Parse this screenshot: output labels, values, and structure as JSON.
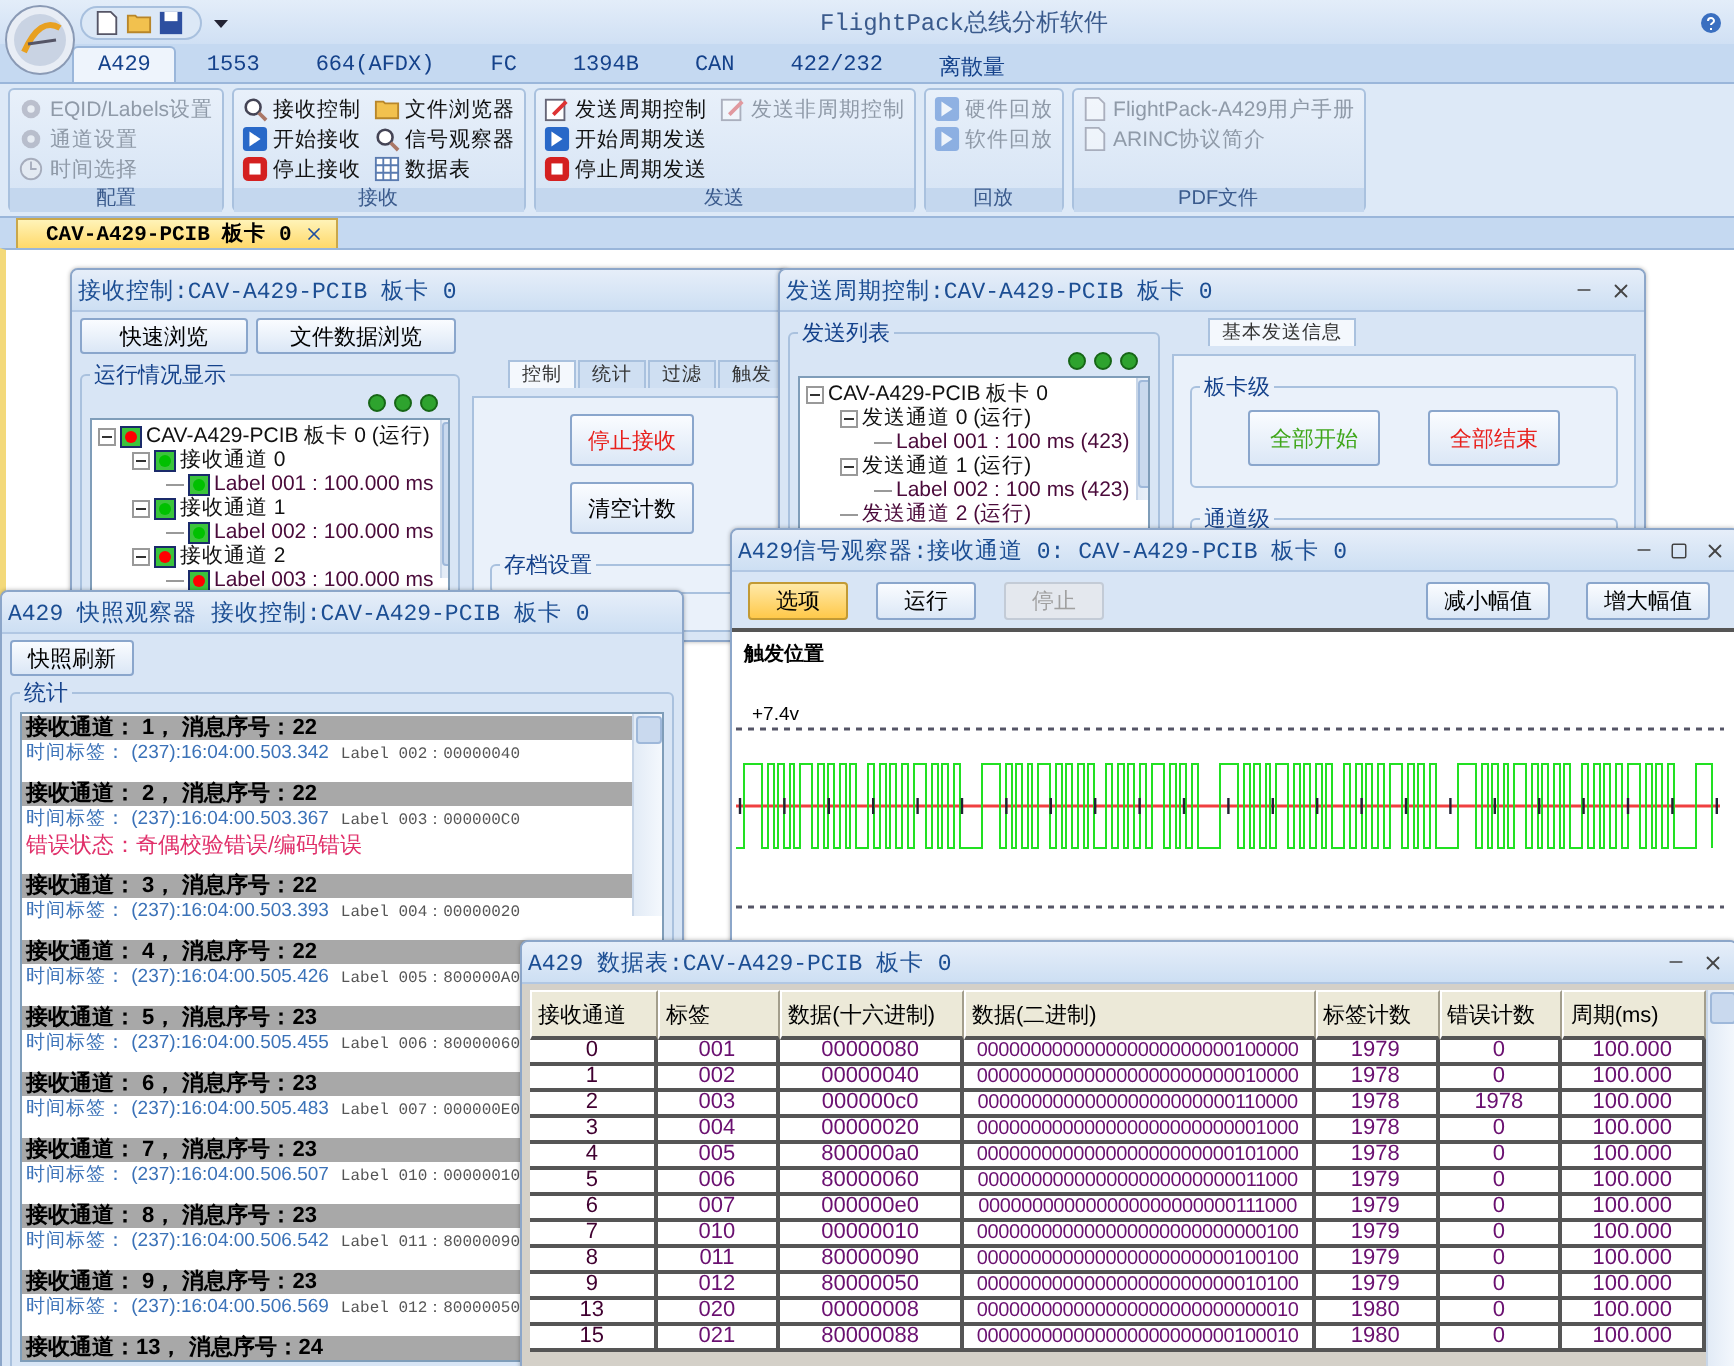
{
  "app": {
    "title": "FlightPack总线分析软件"
  },
  "tabs": [
    {
      "label": "A429",
      "selected": true
    },
    {
      "label": "1553",
      "selected": false
    },
    {
      "label": "664(AFDX)",
      "selected": false
    },
    {
      "label": "FC",
      "selected": false
    },
    {
      "label": "1394B",
      "selected": false
    },
    {
      "label": "CAN",
      "selected": false
    },
    {
      "label": "422/232",
      "selected": false
    },
    {
      "label": "离散量",
      "selected": false
    }
  ],
  "ribbon": {
    "groups": [
      {
        "title": "配置",
        "items": [
          {
            "label": "EQID/Labels设置",
            "disabled": true
          },
          {
            "label": "通道设置",
            "disabled": true
          },
          {
            "label": "时间选择",
            "disabled": true
          }
        ]
      },
      {
        "title": "接收",
        "items": [
          {
            "label": "接收控制",
            "disabled": false
          },
          {
            "label": "开始接收",
            "disabled": false
          },
          {
            "label": "停止接收",
            "disabled": false
          },
          {
            "label": "文件浏览器",
            "disabled": false
          },
          {
            "label": "信号观察器",
            "disabled": false
          },
          {
            "label": "数据表",
            "disabled": false
          }
        ]
      },
      {
        "title": "发送",
        "items": [
          {
            "label": "发送周期控制",
            "disabled": false
          },
          {
            "label": "开始周期发送",
            "disabled": false
          },
          {
            "label": "停止周期发送",
            "disabled": false
          },
          {
            "label": "发送非周期控制",
            "disabled": true
          }
        ]
      },
      {
        "title": "回放",
        "items": [
          {
            "label": "硬件回放",
            "disabled": true
          },
          {
            "label": "软件回放",
            "disabled": true
          }
        ]
      },
      {
        "title": "PDF文件",
        "items": [
          {
            "label": "FlightPack-A429用户手册",
            "disabled": true
          },
          {
            "label": "ARINC协议简介",
            "disabled": true
          }
        ]
      }
    ]
  },
  "document_tab": {
    "label": "CAV-A429-PCIB 板卡 0"
  },
  "receive_window": {
    "title": "接收控制:CAV-A429-PCIB 板卡 0",
    "buttons": [
      "快速浏览",
      "文件数据浏览"
    ],
    "status_group": {
      "title": "运行情况显示",
      "tree": [
        {
          "label": "CAV-A429-PCIB 板卡 0 (运行)",
          "color": "#ff0000",
          "children": [
            {
              "label": "接收通道 0",
              "color": "#00c000",
              "children": [
                {
                  "label": "Label 001 : 100.000 ms",
                  "color": "#00c000"
                }
              ]
            },
            {
              "label": "接收通道 1",
              "color": "#00c000",
              "children": [
                {
                  "label": "Label 002 : 100.000 ms",
                  "color": "#00c000"
                }
              ]
            },
            {
              "label": "接收通道 2",
              "color": "#ff0000",
              "children": [
                {
                  "label": "Label 003 : 100.000 ms",
                  "color": "#ff0000"
                }
              ]
            }
          ]
        }
      ]
    },
    "tabs": [
      {
        "label": "控制",
        "selected": true
      },
      {
        "label": "统计",
        "selected": false
      },
      {
        "label": "过滤",
        "selected": false
      },
      {
        "label": "触发",
        "selected": false
      }
    ],
    "actions": [
      {
        "label": "停止接收",
        "kind": "danger"
      },
      {
        "label": "清空计数",
        "kind": "normal"
      }
    ],
    "archive_group": {
      "title": "存档设置"
    }
  },
  "send_window": {
    "title": "发送周期控制:CAV-A429-PCIB 板卡 0",
    "list_group": {
      "title": "发送列表",
      "tree": [
        {
          "label": "CAV-A429-PCIB 板卡 0",
          "children": [
            {
              "label": "发送通道 0 (运行)",
              "children": [
                {
                  "label": "Label 001 : 100 ms (423)"
                }
              ]
            },
            {
              "label": "发送通道 1 (运行)",
              "children": [
                {
                  "label": "Label 002 : 100 ms (423)"
                }
              ]
            },
            {
              "label": "发送通道 2 (运行)"
            }
          ]
        }
      ]
    },
    "tabs": [
      {
        "label": "基本发送信息",
        "selected": true
      }
    ],
    "board_group": {
      "title": "板卡级",
      "buttons": [
        {
          "label": "全部开始",
          "kind": "start"
        },
        {
          "label": "全部结束",
          "kind": "danger"
        }
      ]
    },
    "channel_group": {
      "title": "通道级"
    }
  },
  "snapshot_window": {
    "title": "A429 快照观察器 接收控制:CAV-A429-PCIB 板卡 0",
    "refresh_button": "快照刷新",
    "group_title": "统计",
    "entries": [
      {
        "header": "接收通道： 1， 消息序号：22",
        "time": "时间标签： (237):16:04:00.503.342",
        "label": "Label 002：00000040"
      },
      {
        "header": "接收通道： 2， 消息序号：22",
        "time": "时间标签： (237):16:04:00.503.367",
        "label": "Label 003：000000C0",
        "error": "错误状态：奇偶校验错误/编码错误"
      },
      {
        "header": "接收通道： 3， 消息序号：22",
        "time": "时间标签： (237):16:04:00.503.393",
        "label": "Label 004：00000020"
      },
      {
        "header": "接收通道： 4， 消息序号：22",
        "time": "时间标签： (237):16:04:00.505.426",
        "label": "Label 005：800000A0"
      },
      {
        "header": "接收通道： 5， 消息序号：23",
        "time": "时间标签： (237):16:04:00.505.455",
        "label": "Label 006：80000060"
      },
      {
        "header": "接收通道： 6， 消息序号：23",
        "time": "时间标签： (237):16:04:00.505.483",
        "label": "Label 007：000000E0"
      },
      {
        "header": "接收通道： 7， 消息序号：23",
        "time": "时间标签： (237):16:04:00.506.507",
        "label": "Label 010：00000010"
      },
      {
        "header": "接收通道： 8， 消息序号：23",
        "time": "时间标签： (237):16:04:00.506.542",
        "label": "Label 011：80000090"
      },
      {
        "header": "接收通道： 9， 消息序号：23",
        "time": "时间标签： (237):16:04:00.506.569",
        "label": "Label 012：80000050"
      },
      {
        "header": "接收通道：13， 消息序号：24"
      }
    ]
  },
  "signal_window": {
    "title": "A429信号观察器:接收通道 0: CAV-A429-PCIB 板卡 0",
    "left_buttons": [
      {
        "label": "选项",
        "active": true,
        "disabled": false
      },
      {
        "label": "运行",
        "active": false,
        "disabled": false
      },
      {
        "label": "停止",
        "active": false,
        "disabled": true
      }
    ],
    "right_buttons": [
      {
        "label": "减小幅值",
        "active": false,
        "disabled": false
      },
      {
        "label": "增大幅值",
        "active": false,
        "disabled": false
      }
    ],
    "plot": {
      "trigger_label": "触发位置",
      "upper_level": "+7.4v"
    }
  },
  "table_window": {
    "title": "A429 数据表:CAV-A429-PCIB 板卡 0",
    "columns": [
      "接收通道",
      "标签",
      "数据(十六进制)",
      "数据(二进制)",
      "标签计数",
      "错误计数",
      "周期(ms)"
    ],
    "rows": [
      [
        "0",
        "001",
        "00000080",
        "000000000000000000000000100000",
        "1979",
        "0",
        "100.000"
      ],
      [
        "1",
        "002",
        "00000040",
        "000000000000000000000000010000",
        "1978",
        "0",
        "100.000"
      ],
      [
        "2",
        "003",
        "000000c0",
        "000000000000000000000000110000",
        "1978",
        "1978",
        "100.000"
      ],
      [
        "3",
        "004",
        "00000020",
        "000000000000000000000000001000",
        "1978",
        "0",
        "100.000"
      ],
      [
        "4",
        "005",
        "800000a0",
        "000000000000000000000000101000",
        "1978",
        "0",
        "100.000"
      ],
      [
        "5",
        "006",
        "80000060",
        "000000000000000000000000011000",
        "1979",
        "0",
        "100.000"
      ],
      [
        "6",
        "007",
        "000000e0",
        "000000000000000000000000111000",
        "1979",
        "0",
        "100.000"
      ],
      [
        "7",
        "010",
        "00000010",
        "000000000000000000000000000100",
        "1979",
        "0",
        "100.000"
      ],
      [
        "8",
        "011",
        "80000090",
        "000000000000000000000000100100",
        "1979",
        "0",
        "100.000"
      ],
      [
        "9",
        "012",
        "80000050",
        "000000000000000000000000010100",
        "1979",
        "0",
        "100.000"
      ],
      [
        "13",
        "020",
        "00000008",
        "000000000000000000000000000010",
        "1980",
        "0",
        "100.000"
      ],
      [
        "15",
        "021",
        "80000088",
        "000000000000000000000000100010",
        "1980",
        "0",
        "100.000"
      ]
    ]
  }
}
